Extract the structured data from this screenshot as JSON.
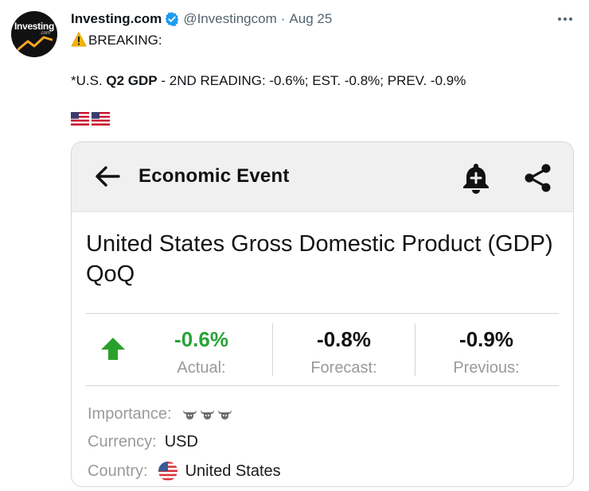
{
  "tweet": {
    "avatar_brand": "Investing",
    "avatar_brand_sub": ".com",
    "display_name": "Investing.com",
    "handle": "@Investingcom",
    "separator": "·",
    "date": "Aug 25",
    "line1": "BREAKING:",
    "line2_prefix": "*U.S. ",
    "line2_bold": "Q2 GDP",
    "line2_suffix": " - 2ND READING: -0.6%; EST. -0.8%; PREV. -0.9%",
    "icons": [
      "verified-badge-icon",
      "more-icon",
      "warning-icon",
      "us-flag-icon"
    ],
    "colors": {
      "verified": "#1d9bf0",
      "secondary_text": "#536471"
    }
  },
  "card": {
    "header_title": "Economic Event",
    "event_title": "United States Gross Domestic Product (GDP) QoQ",
    "icons": [
      "back-arrow-icon",
      "bell-add-icon",
      "share-icon",
      "up-arrow-icon",
      "bull-icon"
    ],
    "stats": {
      "actual_value": "-0.6%",
      "actual_label": "Actual:",
      "forecast_value": "-0.8%",
      "forecast_label": "Forecast:",
      "previous_value": "-0.9%",
      "previous_label": "Previous:"
    },
    "importance_label": "Importance:",
    "importance_level": 3,
    "currency_label": "Currency:",
    "currency_value": "USD",
    "country_label": "Country:",
    "country_value": "United States",
    "colors": {
      "actual": "#29a336",
      "up_arrow": "#2ca02c",
      "header_bg": "#f0f0f0",
      "label": "#9a9a9a"
    }
  }
}
